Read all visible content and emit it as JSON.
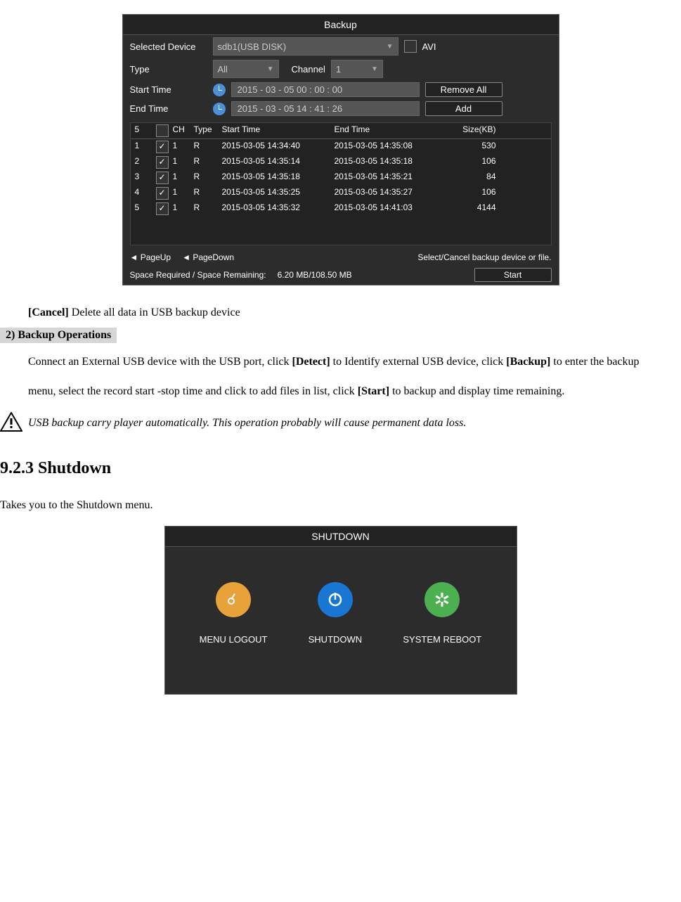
{
  "backup": {
    "title": "Backup",
    "selectedDeviceLabel": "Selected Device",
    "selectedDeviceValue": "sdb1(USB DISK)",
    "aviLabel": "AVI",
    "typeLabel": "Type",
    "typeValue": "All",
    "channelLabel": "Channel",
    "channelValue": "1",
    "startTimeLabel": "Start Time",
    "startTimeValue": "2015  - 03 -  05    00 : 00 :  00",
    "endTimeLabel": "End Time",
    "endTimeValue": "2015  - 03 -  05    14 : 41 :  26",
    "removeAllBtn": "Remove All",
    "addBtn": "Add",
    "headers": {
      "count": "5",
      "ch": "CH",
      "type": "Type",
      "start": "Start Time",
      "end": "End Time",
      "size": "Size(KB)"
    },
    "rows": [
      {
        "idx": "1",
        "checked": true,
        "ch": "1",
        "type": "R",
        "start": "2015-03-05 14:34:40",
        "end": "2015-03-05 14:35:08",
        "size": "530"
      },
      {
        "idx": "2",
        "checked": true,
        "ch": "1",
        "type": "R",
        "start": "2015-03-05 14:35:14",
        "end": "2015-03-05 14:35:18",
        "size": "106"
      },
      {
        "idx": "3",
        "checked": true,
        "ch": "1",
        "type": "R",
        "start": "2015-03-05 14:35:18",
        "end": "2015-03-05 14:35:21",
        "size": "84"
      },
      {
        "idx": "4",
        "checked": true,
        "ch": "1",
        "type": "R",
        "start": "2015-03-05 14:35:25",
        "end": "2015-03-05 14:35:27",
        "size": "106"
      },
      {
        "idx": "5",
        "checked": true,
        "ch": "1",
        "type": "R",
        "start": "2015-03-05 14:35:32",
        "end": "2015-03-05 14:41:03",
        "size": "4144"
      }
    ],
    "pageUp": "PageUp",
    "pageDown": "PageDown",
    "hint": "Select/Cancel backup device or file.",
    "spaceLabel": "Space Required / Space Remaining:",
    "spaceValue": "6.20 MB/108.50 MB",
    "startBtn": "Start"
  },
  "doc": {
    "cancelLabel": "[Cancel]",
    "cancelDesc": " Delete all data in USB backup device",
    "sectionNum": "2)    Backup Operations",
    "para1a": "Connect an External USB device with the USB port, click ",
    "detect": "[Detect]",
    "para1b": " to Identify external USB device, click ",
    "backup": "[Backup]",
    "para1c": " to enter the backup menu, select the record start -stop time and click to add files in list, click ",
    "start": "[Start]",
    "para1d": " to backup and display time remaining.",
    "warn": " USB backup carry player automatically. This operation probably will cause permanent data loss.",
    "h2": "9.2.3  Shutdown",
    "takes": "Takes you to the Shutdown menu."
  },
  "shutdown": {
    "title": "SHUTDOWN",
    "logout": "MENU LOGOUT",
    "shut": "SHUTDOWN",
    "reboot": "SYSTEM REBOOT"
  }
}
